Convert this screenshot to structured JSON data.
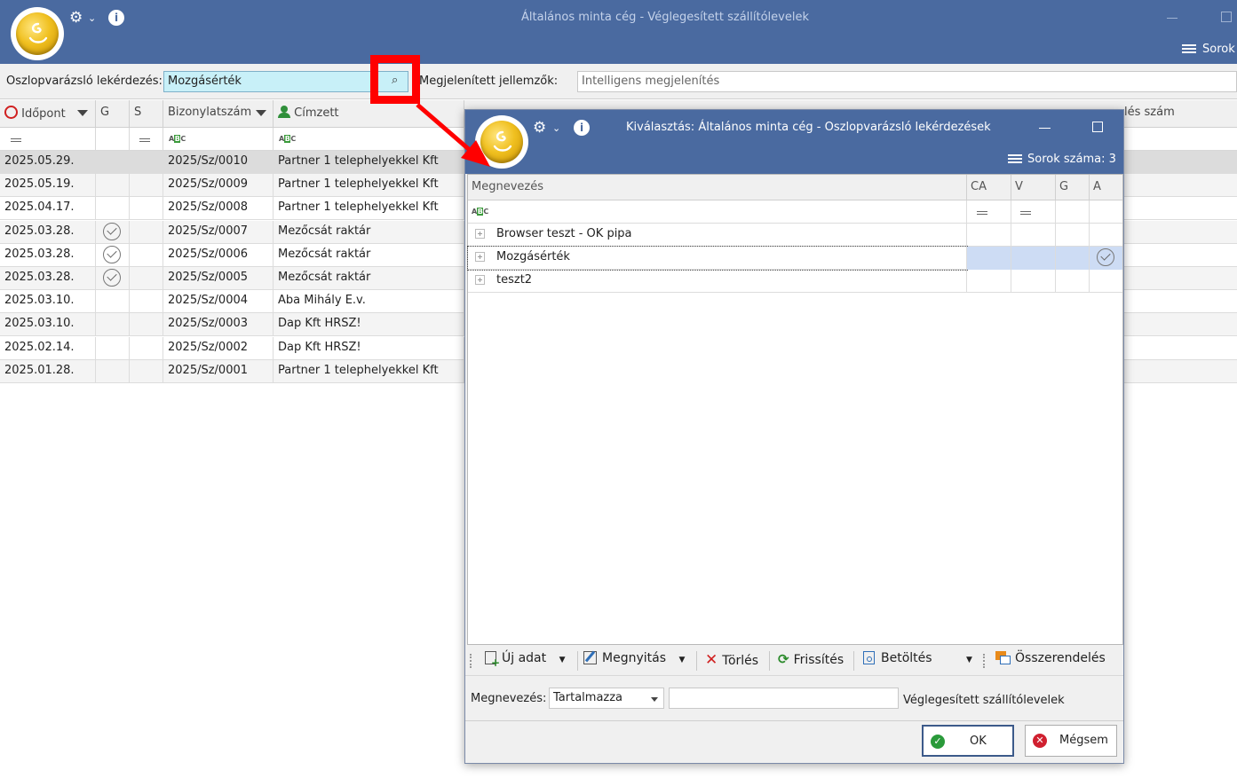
{
  "main_window": {
    "title": "Általános minta cég - Véglegesített szállítólevelek",
    "rows_label": "Sorok"
  },
  "query_bar": {
    "label": "Oszlopvarázsló lekérdezés:",
    "value": "Mozgásérték",
    "features_label": "Megjelenített jellemzők:",
    "features_value": "Intelligens megjelenítés"
  },
  "grid": {
    "columns": {
      "time": "Időpont",
      "g": "G",
      "s": "S",
      "doc_no": "Bizonylatszám",
      "recipient": "Címzett",
      "right_partial": "lés szám"
    },
    "rows": [
      {
        "date": "2025.05.29.",
        "g": false,
        "doc": "2025/Sz/0010",
        "recipient": "Partner 1 telephelyekkel Kft"
      },
      {
        "date": "2025.05.19.",
        "g": false,
        "doc": "2025/Sz/0009",
        "recipient": "Partner 1 telephelyekkel Kft"
      },
      {
        "date": "2025.04.17.",
        "g": false,
        "doc": "2025/Sz/0008",
        "recipient": "Partner 1 telephelyekkel Kft"
      },
      {
        "date": "2025.03.28.",
        "g": true,
        "doc": "2025/Sz/0007",
        "recipient": "Mezőcsát raktár"
      },
      {
        "date": "2025.03.28.",
        "g": true,
        "doc": "2025/Sz/0006",
        "recipient": "Mezőcsát raktár"
      },
      {
        "date": "2025.03.28.",
        "g": true,
        "doc": "2025/Sz/0005",
        "recipient": "Mezőcsát raktár"
      },
      {
        "date": "2025.03.10.",
        "g": false,
        "doc": "2025/Sz/0004",
        "recipient": "Aba Mihály E.v."
      },
      {
        "date": "2025.03.10.",
        "g": false,
        "doc": "2025/Sz/0003",
        "recipient": "Dap Kft HRSZ!"
      },
      {
        "date": "2025.02.14.",
        "g": false,
        "doc": "2025/Sz/0002",
        "recipient": "Dap Kft HRSZ!"
      },
      {
        "date": "2025.01.28.",
        "g": false,
        "doc": "2025/Sz/0001",
        "recipient": "Partner 1 telephelyekkel Kft"
      }
    ]
  },
  "dialog": {
    "title": "Kiválasztás: Általános minta cég - Oszlopvarázsló lekérdezések",
    "row_count_label": "Sorok száma: 3",
    "columns": {
      "name": "Megnevezés",
      "ca": "CA",
      "v": "V",
      "g": "G",
      "a": "A"
    },
    "rows": [
      {
        "name": "Browser teszt - OK pipa",
        "a": false
      },
      {
        "name": "Mozgásérték",
        "a": true
      },
      {
        "name": "teszt2",
        "a": false
      }
    ],
    "toolbar": {
      "new": "Új adat",
      "open": "Megnyitás",
      "delete": "Törlés",
      "refresh": "Frissítés",
      "load": "Betöltés",
      "assign": "Összerendelés"
    },
    "filter": {
      "label": "Megnevezés:",
      "mode": "Tartalmazza",
      "text": "",
      "context": "Véglegesített szállítólevelek"
    },
    "buttons": {
      "ok": "OK",
      "cancel": "Mégsem"
    }
  },
  "colors": {
    "titlebar": "#4a6aa0",
    "annotation": "#ff0000",
    "selected_query": "#c8f0f8"
  }
}
